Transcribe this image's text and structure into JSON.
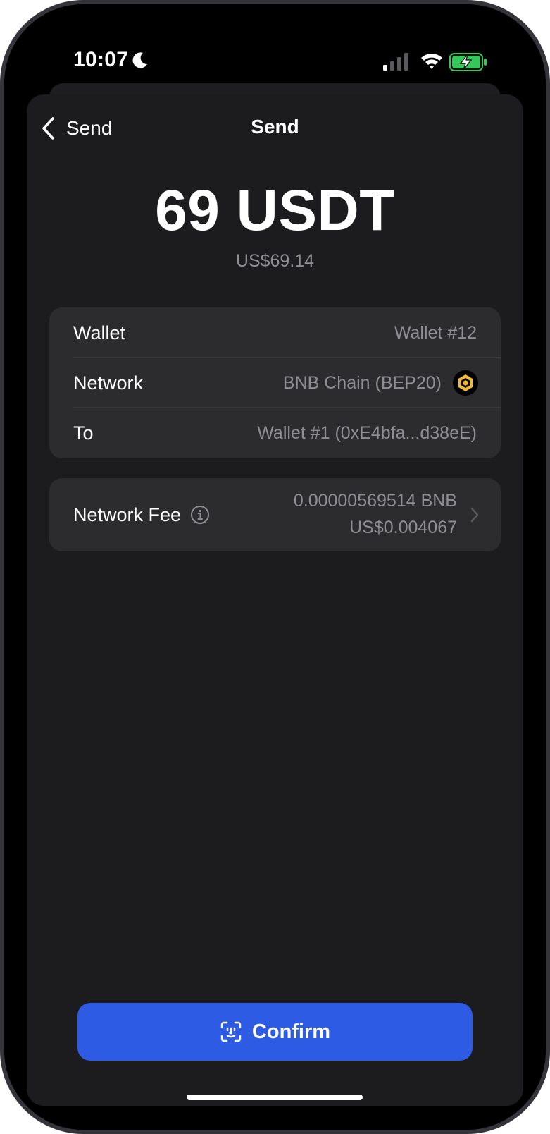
{
  "status_bar": {
    "time": "10:07",
    "icons": [
      "moon-icon",
      "signal-icon",
      "wifi-icon",
      "battery-charging-icon"
    ]
  },
  "nav": {
    "back_label": "Send",
    "title": "Send"
  },
  "amount": {
    "value": "69 USDT",
    "fiat": "US$69.14"
  },
  "details": {
    "wallet_label": "Wallet",
    "wallet_value": "Wallet #12",
    "network_label": "Network",
    "network_value": "BNB Chain (BEP20)",
    "network_icon": "bnb-icon",
    "to_label": "To",
    "to_value": "Wallet #1 (0xE4bfa...d38eE)"
  },
  "fee": {
    "label": "Network Fee",
    "crypto": "0.00000569514 BNB",
    "fiat": "US$0.004067"
  },
  "confirm": {
    "label": "Confirm",
    "icon": "face-id-icon"
  },
  "colors": {
    "background": "#000000",
    "sheet": "#1c1c1e",
    "card": "#2c2c2e",
    "accent": "#2d5be3",
    "secondary_text": "#8e8e93",
    "bnb": "#f3ba2f",
    "battery": "#34c759"
  }
}
